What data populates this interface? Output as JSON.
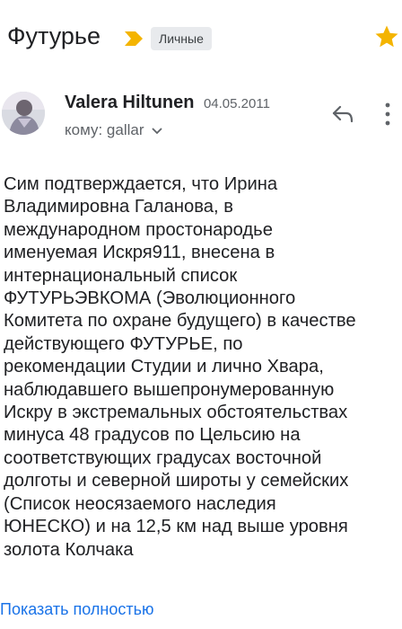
{
  "subject": {
    "title": "Футурье",
    "label": "Личные",
    "starred": true,
    "important_color": "#f4b400",
    "star_color": "#f4b400"
  },
  "message": {
    "sender_name": "Valera Hiltunen",
    "date": "04.05.2011",
    "recipient": "кому: gallar",
    "body": "Сим подтверждается, что Ирина\nВладимировна Галанова, в\nмеждународном простонародье\nименуемая Искря911, внесена в\nинтернациональный список\nФУТУРЬЭВКОМА (Эволюционного\nКомитета по охране будущего) в качестве\nдействующего ФУТУРЬЕ,  по\nрекомендации Студии и лично Хвара,\nнаблюдавшего вышепронумерованную\nИскру в экстремальных обстоятельствах\nминуса 48 градусов по Цельсию на\nсоответствующих  градусах восточной\nдолготы и северной широты у семейских\n(Список неосязаемого наследия\nЮНЕСКО) и на 12,5 км над выше уровня\nзолота Колчака",
    "show_more": "Показать полностью"
  },
  "icons": {
    "important": "important-marker-icon",
    "star": "star-icon",
    "reply": "reply-icon",
    "more": "more-vert-icon",
    "chevron": "chevron-down-icon"
  },
  "colors": {
    "link": "#1a73e8",
    "secondary_text": "#5f6368"
  }
}
